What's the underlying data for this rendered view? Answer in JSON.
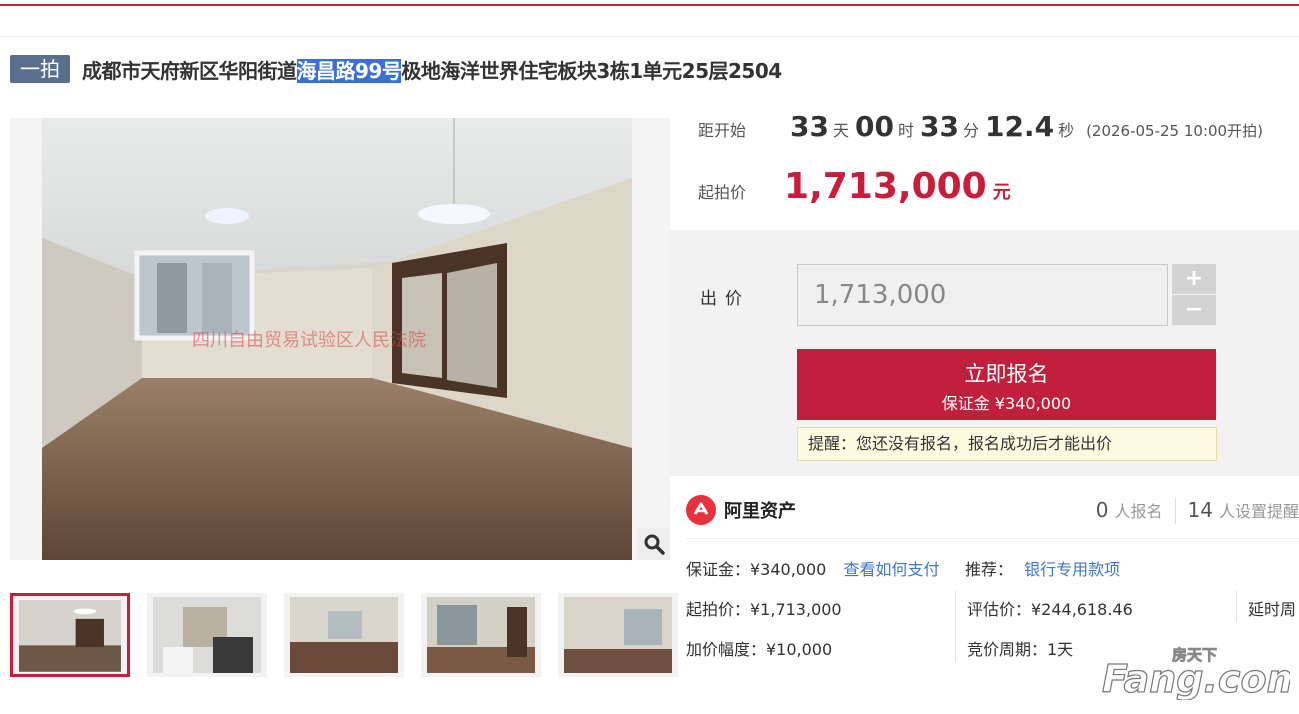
{
  "title": {
    "tag": "一拍",
    "prefix": "成都市天府新区华阳街道",
    "highlight": "海昌路99号",
    "suffix": "极地海洋世界住宅板块3栋1单元25层2504"
  },
  "photo": {
    "watermark_text": "四川自由贸易试验区人民法院"
  },
  "countdown": {
    "label": "距开始",
    "days": "33",
    "days_unit": "天",
    "hours": "00",
    "hours_unit": "时",
    "minutes": "33",
    "minutes_unit": "分",
    "seconds": "12.4",
    "seconds_unit": "秒",
    "start_note": "(2026-05-25 10:00开拍)"
  },
  "start_price": {
    "label": "起拍价",
    "value": "1,713,000",
    "unit": "元"
  },
  "bid": {
    "label": "出价",
    "input_value": "1,713,000",
    "plus": "+",
    "minus": "−",
    "signup_label": "立即报名",
    "deposit_line": "保证金 ¥340,000",
    "reminder": "提醒：您还没有报名，报名成功后才能出价"
  },
  "platform": {
    "name": "阿里资产",
    "signup_count": "0",
    "signup_label": "人报名",
    "remind_count": "14",
    "remind_label": "人设置提醒"
  },
  "details": {
    "deposit": "保证金：¥340,000",
    "how_to_pay": "查看如何支付",
    "recommend_label": "推荐：",
    "recommend_link": "银行专用款项",
    "start_price": "起拍价：¥1,713,000",
    "appraisal": "评估价：¥244,618.46",
    "delay": "延时周",
    "increment": "加价幅度：¥10,000",
    "cycle": "竞价周期：1天"
  },
  "site_watermark": {
    "top": "房天下",
    "main": "Fang.com"
  },
  "colors": {
    "brand_red": "#c81e3c",
    "tag_bg": "#5a6f8e",
    "link_blue": "#3a78c8",
    "panel_gray": "#f2f2f2"
  }
}
